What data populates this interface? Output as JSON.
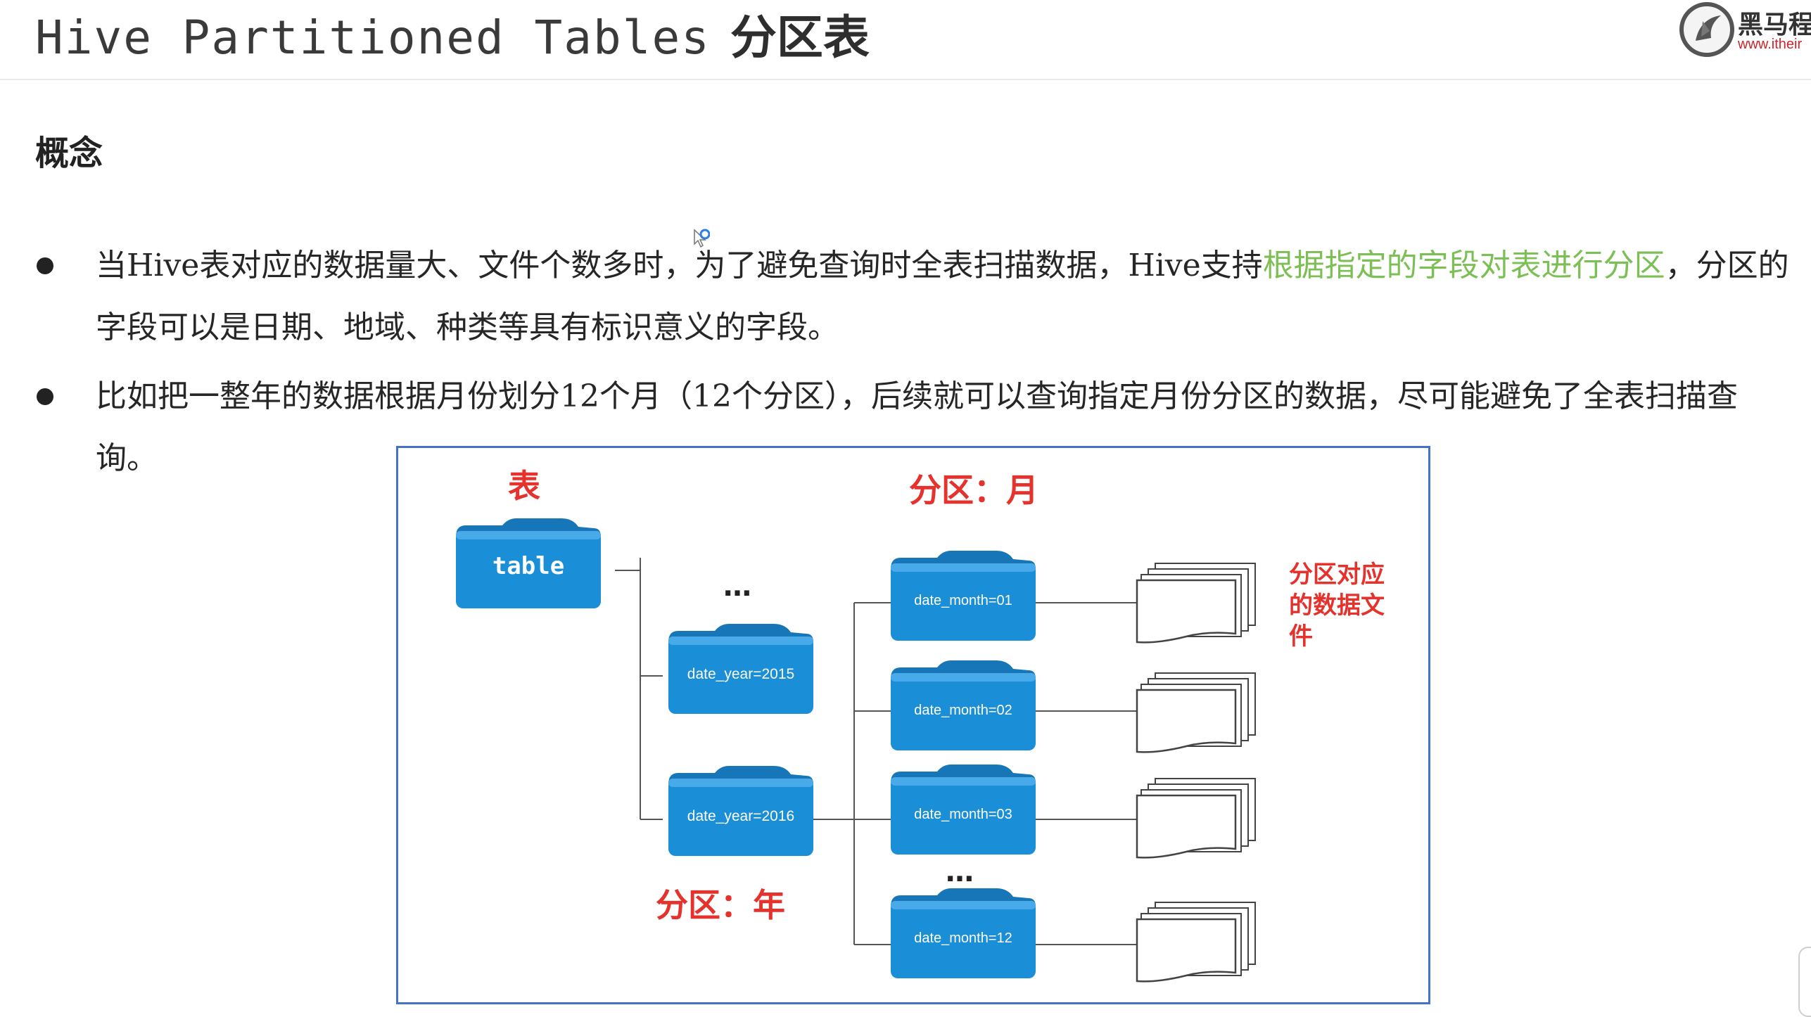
{
  "header": {
    "title_en": "Hive Partitioned Tables",
    "title_zh": "分区表",
    "logo_text": "黑马程",
    "logo_url": "www.itheir"
  },
  "section": {
    "heading": "概念"
  },
  "bullets": [
    {
      "parts": [
        {
          "text": "当",
          "style": "normal"
        },
        {
          "text": "Hive",
          "style": "mono"
        },
        {
          "text": "表对应的数据量大、文件个数多时，为了避免查询时全表扫描数据，",
          "style": "normal"
        },
        {
          "text": "Hive",
          "style": "mono"
        },
        {
          "text": "支持",
          "style": "normal"
        },
        {
          "text": "根据指定的字段对表进行分区",
          "style": "green"
        },
        {
          "text": "，分区的字段可以是日期、地域、种类等具有标识意义的字段。",
          "style": "normal"
        }
      ]
    },
    {
      "parts": [
        {
          "text": "比如把一整年的数据根据月份划分",
          "style": "normal"
        },
        {
          "text": "12",
          "style": "mono"
        },
        {
          "text": "个月（",
          "style": "normal"
        },
        {
          "text": "12",
          "style": "mono"
        },
        {
          "text": "个分区），后续就可以查询指定月份分区的数据，尽可能避免了全表扫描查询。",
          "style": "normal"
        }
      ]
    }
  ],
  "diagram": {
    "label_table": "表",
    "label_partition_month": "分区：月",
    "label_partition_year": "分区：年",
    "label_files_line1": "分区对应",
    "label_files_line2": "的数据文",
    "label_files_line3": "件",
    "table_folder": "table",
    "year_folders": [
      "date_year=2015",
      "date_year=2016"
    ],
    "month_folders": [
      "date_month=01",
      "date_month=02",
      "date_month=03",
      "date_month=12"
    ],
    "ellipsis": "…",
    "colors": {
      "folder_blue": "#1a8fd8",
      "folder_tab": "#1676b8",
      "label_red": "#e5322d",
      "border_blue": "#4472c4"
    }
  }
}
